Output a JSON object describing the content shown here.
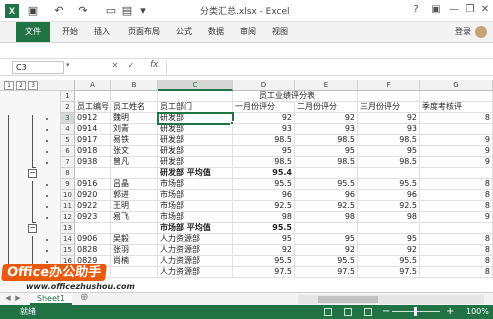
{
  "titlebar": {
    "app_icon": "X",
    "title": "分类汇总.xlsx - Excel",
    "help": "?",
    "minimize": "—",
    "restore": "❐",
    "close": "✕"
  },
  "ribbon": {
    "tabs": [
      "文件",
      "开始",
      "插入",
      "页面布局",
      "公式",
      "数据",
      "审阅",
      "视图"
    ],
    "login": "登录"
  },
  "formula_bar": {
    "name_box": "C3",
    "fx": "fx",
    "value": ""
  },
  "outline": {
    "levels": [
      "1",
      "2",
      "3"
    ]
  },
  "columns": [
    "A",
    "B",
    "C",
    "D",
    "E",
    "F",
    "G"
  ],
  "rows": [
    {
      "num": "1",
      "cells": [
        "",
        "",
        "",
        "员工业绩评分表",
        "",
        "",
        ""
      ]
    },
    {
      "num": "2",
      "cells": [
        "员工编号",
        "员工姓名",
        "员工部门",
        "一月份评分",
        "二月份评分",
        "三月份评分",
        "季度考核评"
      ]
    },
    {
      "num": "3",
      "cells": [
        "0912",
        "魏明",
        "研发部",
        "92",
        "92",
        "92",
        "8"
      ]
    },
    {
      "num": "4",
      "cells": [
        "0914",
        "刘青",
        "研发部",
        "93",
        "93",
        "93",
        ""
      ]
    },
    {
      "num": "5",
      "cells": [
        "0917",
        "易铁",
        "研发部",
        "98.5",
        "98.5",
        "98.5",
        "9"
      ]
    },
    {
      "num": "6",
      "cells": [
        "0918",
        "张文",
        "研发部",
        "95",
        "95",
        "95",
        "9"
      ]
    },
    {
      "num": "7",
      "cells": [
        "0938",
        "曾凡",
        "研发部",
        "98.5",
        "98.5",
        "98.5",
        "9"
      ]
    },
    {
      "num": "8",
      "cells": [
        "",
        "",
        "研发部 平均值",
        "95.4",
        "",
        "",
        ""
      ]
    },
    {
      "num": "9",
      "cells": [
        "0916",
        "吕晶",
        "市场部",
        "95.5",
        "95.5",
        "95.5",
        "8"
      ]
    },
    {
      "num": "10",
      "cells": [
        "0920",
        "郭进",
        "市场部",
        "96",
        "96",
        "96",
        "8"
      ]
    },
    {
      "num": "11",
      "cells": [
        "0922",
        "王明",
        "市场部",
        "92.5",
        "92.5",
        "92.5",
        "8"
      ]
    },
    {
      "num": "12",
      "cells": [
        "0923",
        "易飞",
        "市场部",
        "98",
        "98",
        "98",
        "9"
      ]
    },
    {
      "num": "13",
      "cells": [
        "",
        "",
        "市场部 平均值",
        "95.5",
        "",
        "",
        ""
      ]
    },
    {
      "num": "14",
      "cells": [
        "0906",
        "吴毅",
        "人力资源部",
        "95",
        "95",
        "95",
        "8"
      ]
    },
    {
      "num": "15",
      "cells": [
        "0828",
        "张羽",
        "人力资源部",
        "92",
        "92",
        "92",
        "8"
      ]
    },
    {
      "num": "16",
      "cells": [
        "0829",
        "尚楠",
        "人力资源部",
        "95.5",
        "95.5",
        "95.5",
        "8"
      ]
    },
    {
      "num": "17",
      "cells": [
        "0830",
        "",
        "人力资源部",
        "97.5",
        "97.5",
        "97.5",
        "8"
      ]
    }
  ],
  "sheetbar": {
    "sheet_tab": "Sheet1"
  },
  "statusbar": {
    "ready": "就绪",
    "zoom": "100%",
    "zoom_minus": "−",
    "zoom_plus": "+"
  },
  "watermark": {
    "brand": "Office办公助手",
    "url": "www.officezhushou.com"
  },
  "colors": {
    "accent": "#217346",
    "watermark": "#e8590c"
  }
}
